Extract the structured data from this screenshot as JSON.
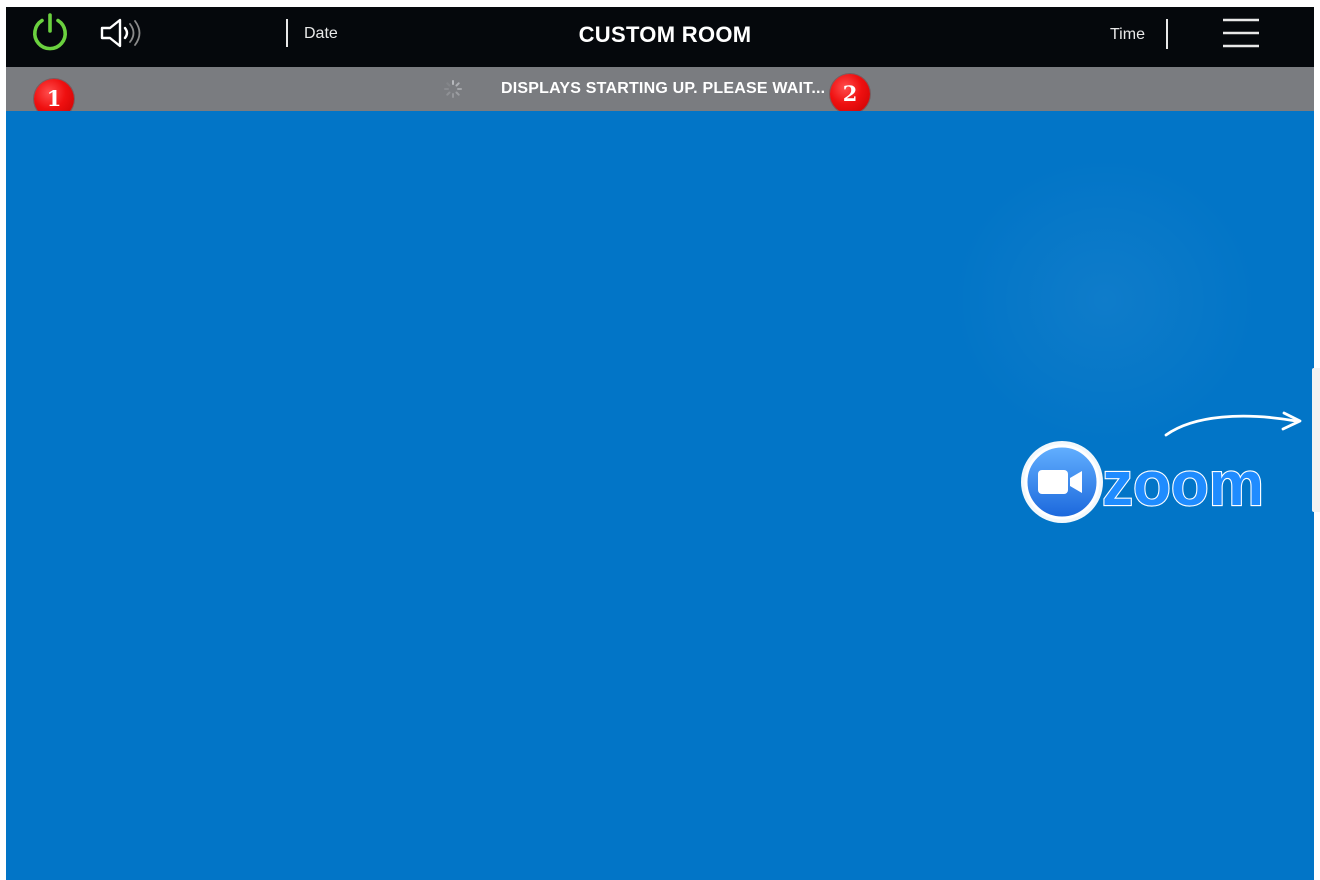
{
  "header": {
    "date_label": "Date",
    "room_title": "CUSTOM ROOM",
    "time_label": "Time"
  },
  "status": {
    "message": "DISPLAYS STARTING UP. PLEASE WAIT..."
  },
  "callouts": {
    "first": "1",
    "second": "2"
  },
  "icons": {
    "power": "power-icon",
    "volume": "volume-icon",
    "menu": "menu-icon",
    "spinner": "spinner-icon",
    "camera": "camera-icon",
    "arrow": "arrow-icon"
  },
  "zoom": {
    "logo_text": "zoom"
  },
  "colors": {
    "top_bar": "#05080c",
    "status_bar": "#7a7c80",
    "main_background": "#0275c7",
    "power_green": "#6bd13f",
    "callout_red": "#ef1010",
    "zoom_blue": "#2d8cff"
  }
}
